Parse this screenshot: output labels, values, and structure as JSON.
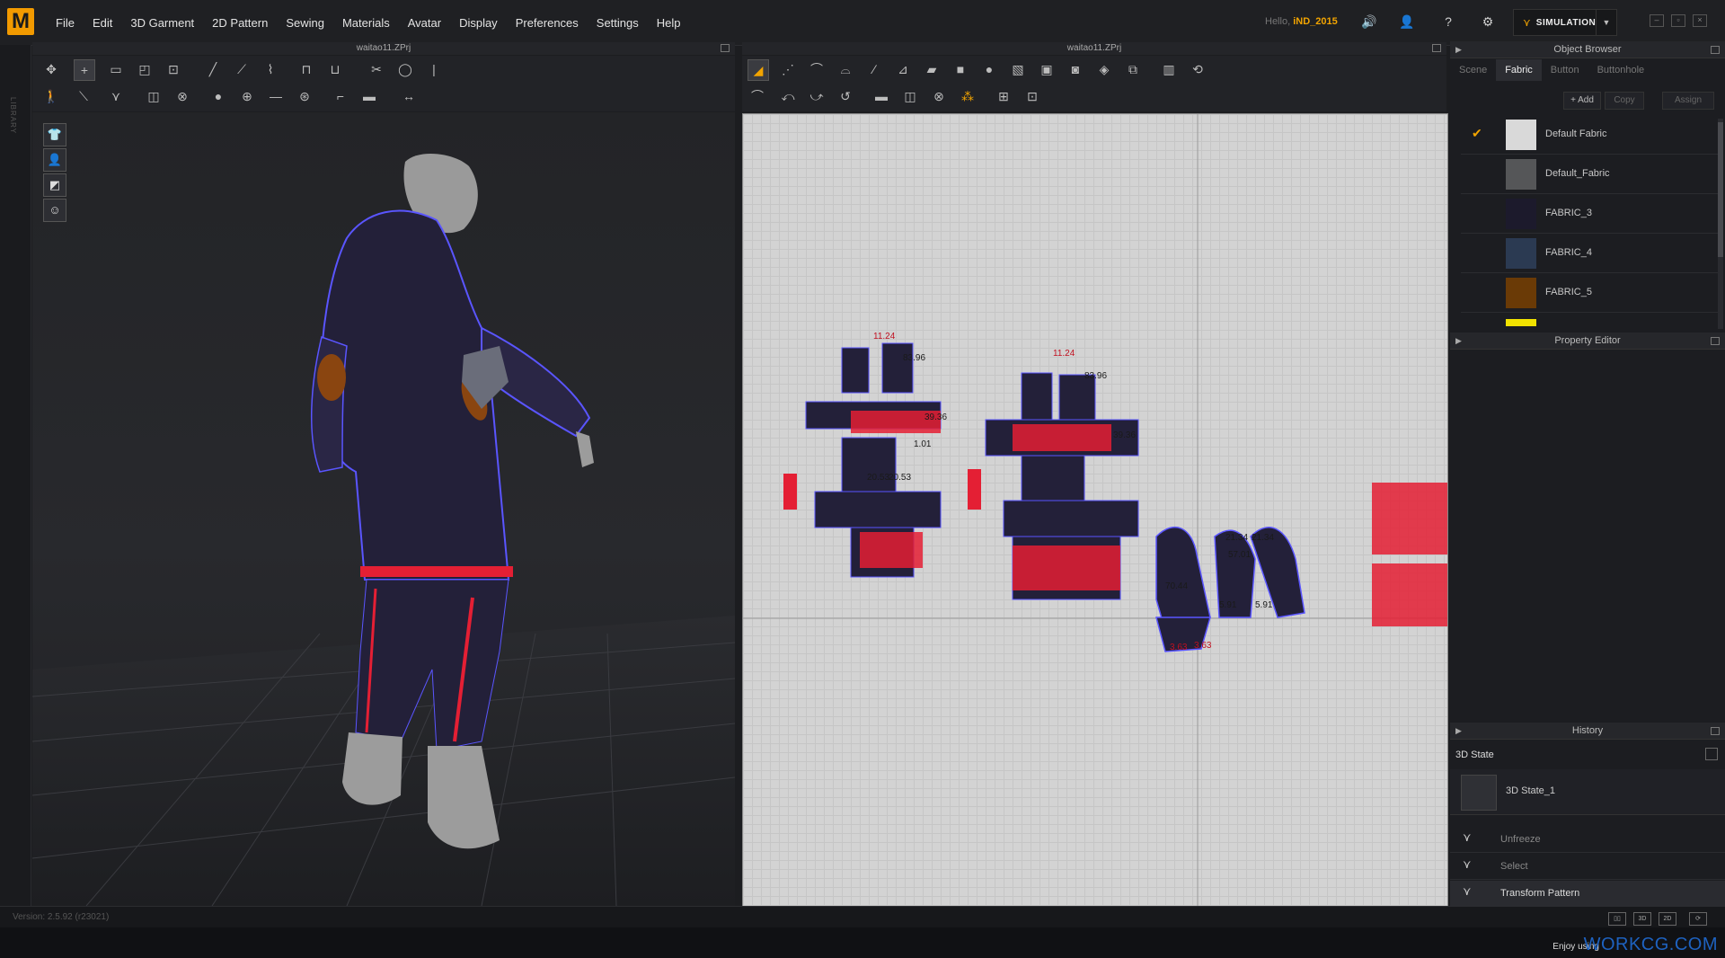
{
  "app": {
    "logo": "M"
  },
  "menu": [
    "File",
    "Edit",
    "3D Garment",
    "2D Pattern",
    "Sewing",
    "Materials",
    "Avatar",
    "Display",
    "Preferences",
    "Settings",
    "Help"
  ],
  "user": {
    "hello": "Hello,",
    "name": "iND_2015"
  },
  "simulation": {
    "label": "SIMULATION"
  },
  "left_strip": {
    "label": "LIBRARY"
  },
  "panels": {
    "view3d_title": "waitao11.ZPrj",
    "view2d_title": "waitao11.ZPrj"
  },
  "object_browser": {
    "title": "Object Browser",
    "tabs": [
      "Scene",
      "Fabric",
      "Button",
      "Buttonhole"
    ],
    "active_tab": "Fabric",
    "buttons": {
      "add": "+ Add",
      "copy": "Copy",
      "assign": "Assign"
    },
    "fabrics": [
      {
        "name": "Default Fabric",
        "color": "#d9d9d9",
        "checked": true
      },
      {
        "name": "Default_Fabric",
        "color": "#555658",
        "checked": false
      },
      {
        "name": "FABRIC_3",
        "color": "#1c1a2c",
        "checked": false
      },
      {
        "name": "FABRIC_4",
        "color": "#2b3a52",
        "checked": false
      },
      {
        "name": "FABRIC_5",
        "color": "#6a3a06",
        "checked": false
      }
    ],
    "partial_swatch_color": "#f2e200"
  },
  "property_editor": {
    "title": "Property Editor"
  },
  "history": {
    "title": "History",
    "state_label": "3D State",
    "state_item": "3D State_1",
    "rows": [
      "Unfreeze",
      "Select",
      "Transform Pattern"
    ]
  },
  "status": {
    "version": "Version: 2.5.92   (r23021)"
  },
  "footer": {
    "enjoy": "Enjoy using",
    "brand": "WORKCG.COM"
  },
  "pattern_labels": [
    "11.24",
    "83.96",
    "39.36",
    "1.01",
    "11.24",
    "83.96",
    "39.36",
    "20.53",
    "20.53",
    "21.34",
    "21.34",
    "57.01",
    "5.91",
    "5.91",
    "70.44",
    "3.63",
    "3.63"
  ],
  "colors": {
    "accent": "#f2a400",
    "garment": "#232039",
    "stitch": "#5a55ff",
    "pattern_bg": "#d3d3d3"
  }
}
